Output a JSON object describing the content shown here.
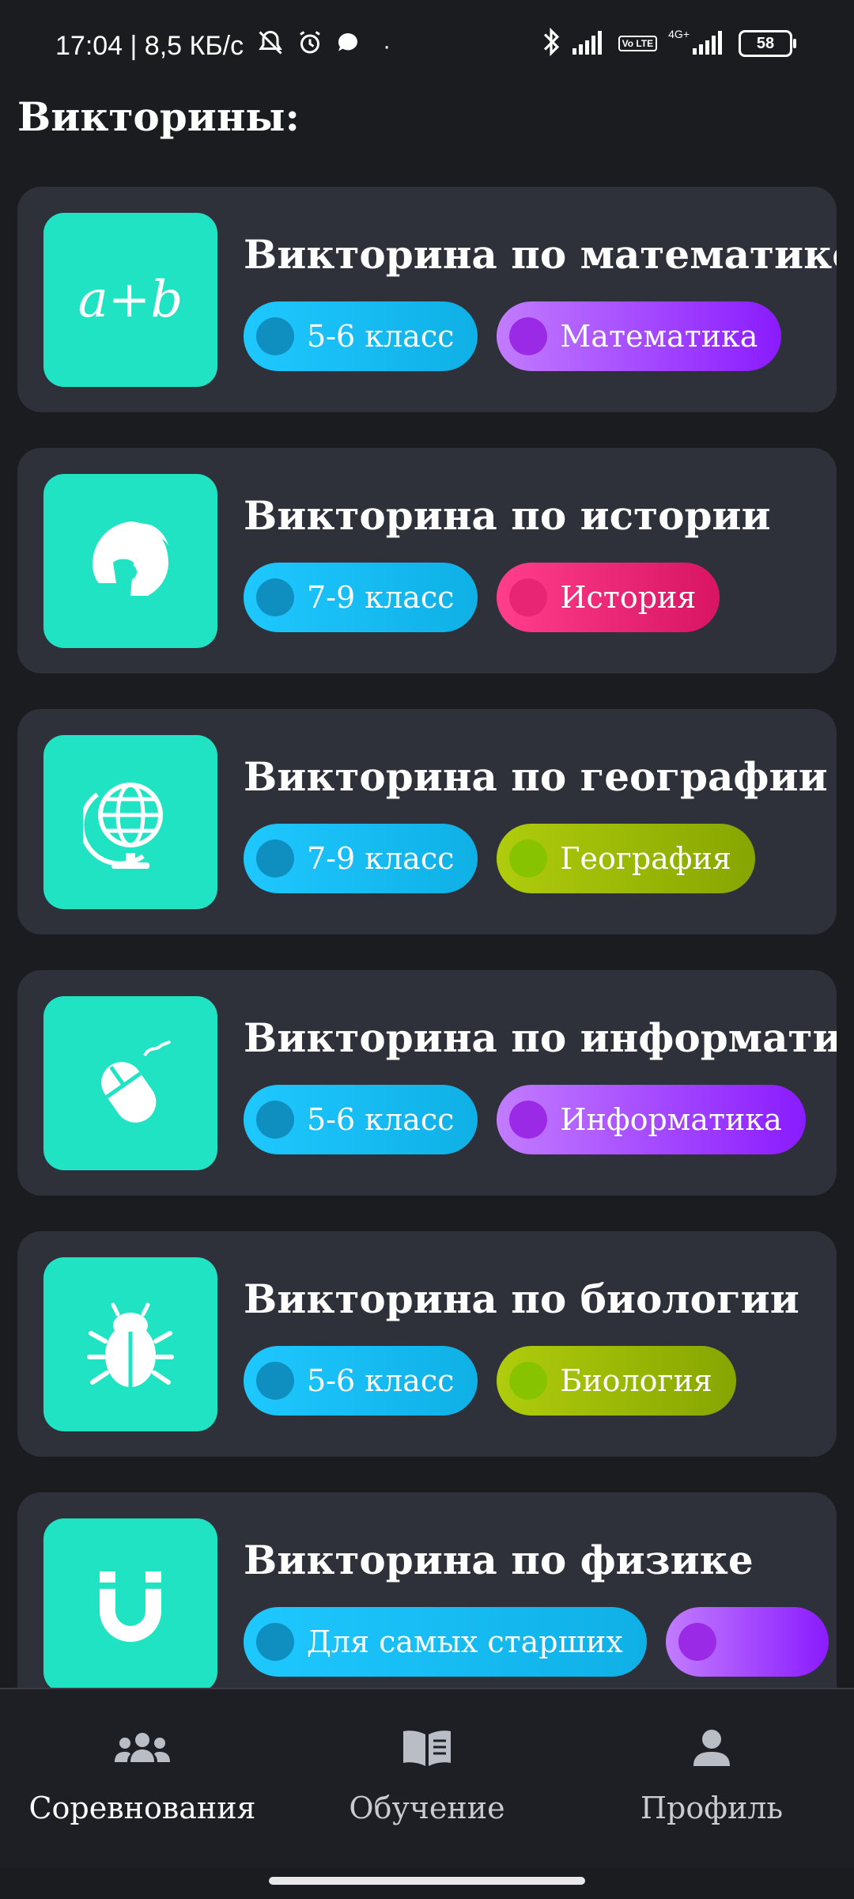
{
  "status_bar": {
    "time_info": "17:04 | 8,5 КБ/с",
    "network": "4G+",
    "volte": "Vo LTE",
    "battery": "58"
  },
  "page_title": "Викторины:",
  "quizzes": [
    {
      "title": "Викторина по математике",
      "icon": "a+b",
      "icon_name": "formula-icon",
      "grade": "5-6 класс",
      "subject": "Математика",
      "subject_color": "purple"
    },
    {
      "title": "Викторина по истории",
      "icon_name": "spartan-helmet-icon",
      "grade": "7-9 класс",
      "subject": "История",
      "subject_color": "pink"
    },
    {
      "title": "Викторина по географии",
      "icon_name": "globe-icon",
      "grade": "7-9 класс",
      "subject": "География",
      "subject_color": "green"
    },
    {
      "title": "Викторина по информатике",
      "icon_name": "mouse-icon",
      "grade": "5-6 класс",
      "subject": "Информатика",
      "subject_color": "purple"
    },
    {
      "title": "Викторина по биологии",
      "icon_name": "bug-icon",
      "grade": "5-6 класс",
      "subject": "Биология",
      "subject_color": "green"
    },
    {
      "title": "Викторина по физике",
      "icon_name": "magnet-icon",
      "grade": "Для самых старших",
      "subject": "",
      "subject_color": "purple"
    }
  ],
  "bottom_nav": [
    {
      "label": "Соревнования",
      "icon_name": "users-icon",
      "active": true
    },
    {
      "label": "Обучение",
      "icon_name": "book-icon",
      "active": false
    },
    {
      "label": "Профиль",
      "icon_name": "user-icon",
      "active": false
    }
  ],
  "colors": {
    "background": "#1b1c20",
    "card": "#2e3139",
    "thumb": "#20e3c4",
    "grade_chip": "#1ec8ff",
    "purple_chip": "#8a1bff",
    "pink_chip": "#ff3e8c",
    "green_chip": "#b0cc0c"
  }
}
